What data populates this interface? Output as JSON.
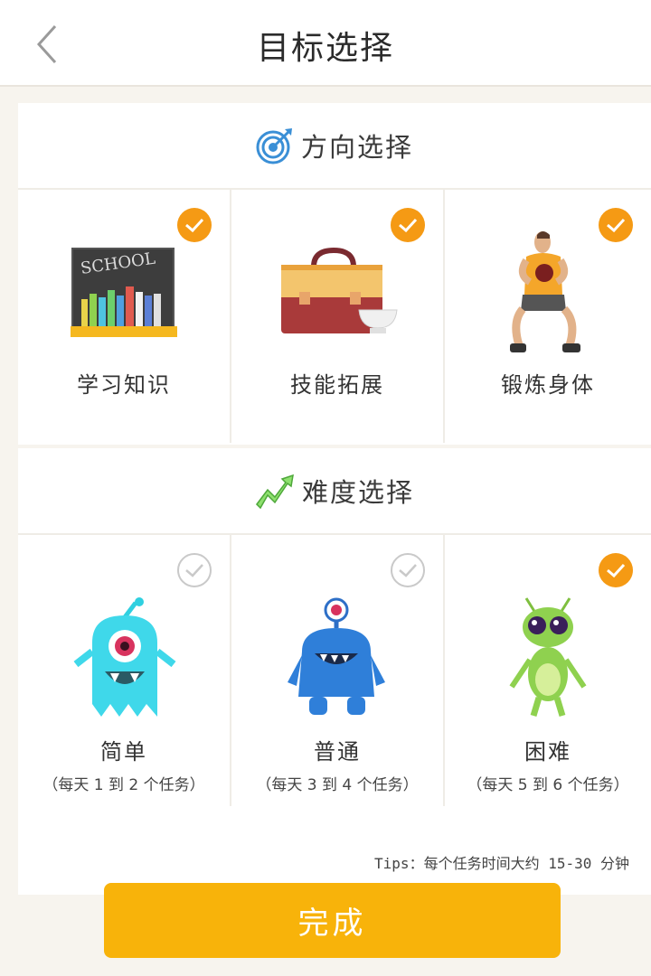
{
  "header": {
    "title": "目标选择",
    "back_icon": "chevron-left-icon"
  },
  "direction": {
    "title": "方向选择",
    "icon": "target-icon",
    "options": [
      {
        "label": "学习知识",
        "selected": true,
        "icon": "school-chalkboard-icon",
        "board_text": "SCHOOL"
      },
      {
        "label": "技能拓展",
        "selected": true,
        "icon": "briefcase-icon"
      },
      {
        "label": "锻炼身体",
        "selected": true,
        "icon": "exercise-person-icon"
      }
    ]
  },
  "difficulty": {
    "title": "难度选择",
    "icon": "trend-arrow-icon",
    "options": [
      {
        "label": "简单",
        "sub": "（每天 1 到 2 个任务）",
        "selected": false,
        "icon": "cyan-monster-icon"
      },
      {
        "label": "普通",
        "sub": "（每天 3 到 4 个任务）",
        "selected": false,
        "icon": "blue-monster-icon"
      },
      {
        "label": "困难",
        "sub": "（每天 5 到 6 个任务）",
        "selected": true,
        "icon": "green-alien-icon"
      }
    ]
  },
  "tips": "Tips：每个任务时间大约 15-30 分钟",
  "done_label": "完成",
  "colors": {
    "accent_orange": "#f59a14",
    "button_yellow": "#f8b30a",
    "background": "#f7f4ee"
  }
}
